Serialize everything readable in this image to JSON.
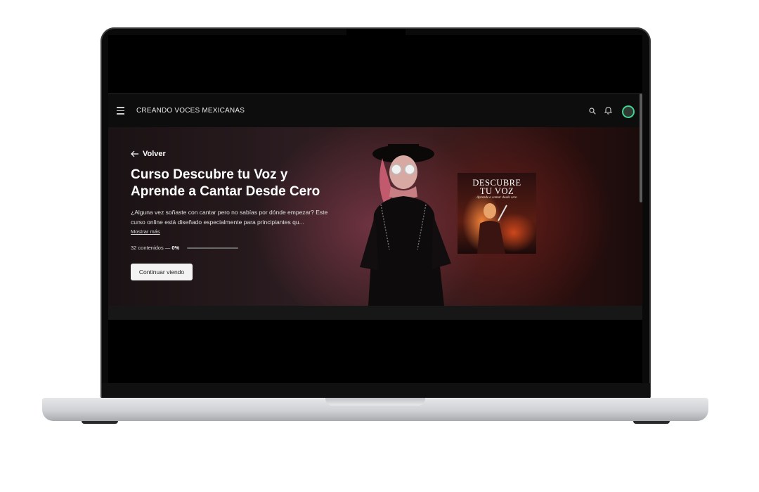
{
  "app": {
    "brand": "CREANDO VOCES MEXICANAS",
    "icons": [
      "menu-icon",
      "search-icon",
      "bell-icon",
      "avatar"
    ]
  },
  "hero": {
    "back_label": "Volver",
    "title": "Curso Descubre tu Voz y Aprende a Cantar Desde Cero",
    "description": "¿Alguna vez soñaste con cantar pero no sabías por dónde empezar? Este curso online está diseñado especialmente para principiantes qu...",
    "show_more": "Mostrar más",
    "contents": "32 contenidos —",
    "progress_label": "0%",
    "progress": 0,
    "continue_label": "Continuar viendo"
  },
  "cover": {
    "title_line1": "DESCUBRE",
    "title_line2": "TU VOZ",
    "subtitle": "Aprende a cantar desde cero"
  },
  "colors": {
    "accent_avatar": "#42d392",
    "button_bg": "#f3f3f3"
  }
}
